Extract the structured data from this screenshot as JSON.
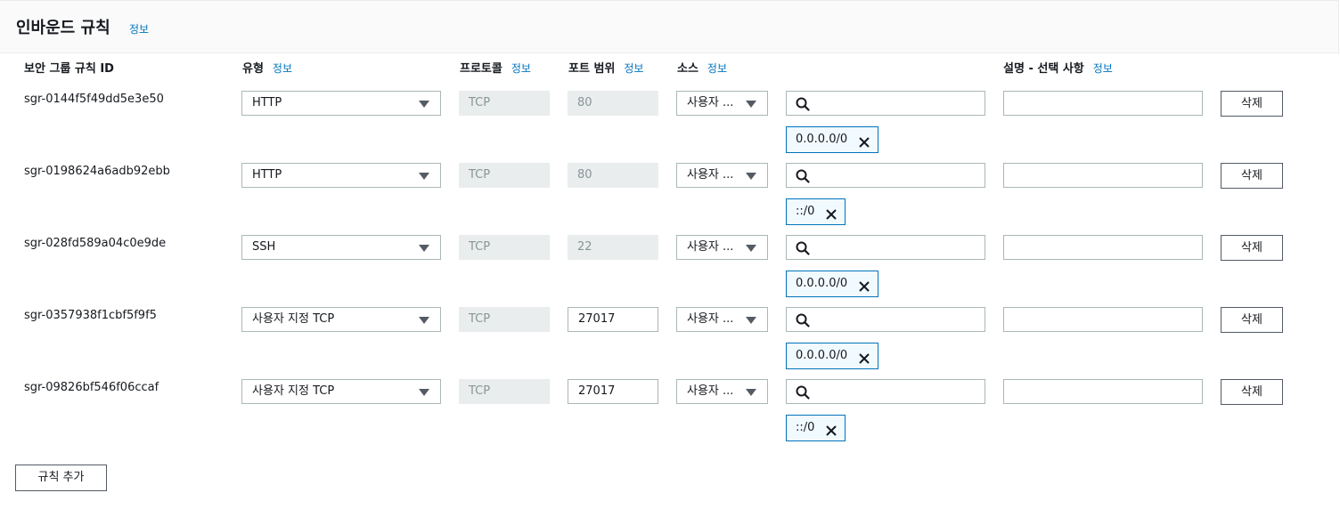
{
  "panel": {
    "title": "인바운드 규칙",
    "info": "정보"
  },
  "columns": {
    "rule_id": "보안 그룹 규칙 ID",
    "type": "유형",
    "protocol": "프로토콜",
    "port_range": "포트 범위",
    "source": "소스",
    "description": "설명 - 선택 사항",
    "info": "정보"
  },
  "rules": [
    {
      "id": "sgr-0144f5f49dd5e3e50",
      "type": "HTTP",
      "protocol": "TCP",
      "port": "80",
      "port_editable": false,
      "source": "사용자 ...",
      "cidr": "0.0.0.0/0",
      "delete": "삭제"
    },
    {
      "id": "sgr-0198624a6adb92ebb",
      "type": "HTTP",
      "protocol": "TCP",
      "port": "80",
      "port_editable": false,
      "source": "사용자 ...",
      "cidr": "::/0",
      "delete": "삭제"
    },
    {
      "id": "sgr-028fd589a04c0e9de",
      "type": "SSH",
      "protocol": "TCP",
      "port": "22",
      "port_editable": false,
      "source": "사용자 ...",
      "cidr": "0.0.0.0/0",
      "delete": "삭제"
    },
    {
      "id": "sgr-0357938f1cbf5f9f5",
      "type": "사용자 지정 TCP",
      "protocol": "TCP",
      "port": "27017",
      "port_editable": true,
      "source": "사용자 ...",
      "cidr": "0.0.0.0/0",
      "delete": "삭제"
    },
    {
      "id": "sgr-09826bf546f06ccaf",
      "type": "사용자 지정 TCP",
      "protocol": "TCP",
      "port": "27017",
      "port_editable": true,
      "source": "사용자 ...",
      "cidr": "::/0",
      "delete": "삭제"
    }
  ],
  "add_rule_label": "규칙 추가",
  "icons": {
    "search": "search-icon",
    "remove": "close-icon",
    "dropdown": "caret-down-icon"
  },
  "colors": {
    "link": "#0073bb",
    "token_border": "#0073bb",
    "token_bg": "#f1faff",
    "disabled_bg": "#eaeded"
  }
}
